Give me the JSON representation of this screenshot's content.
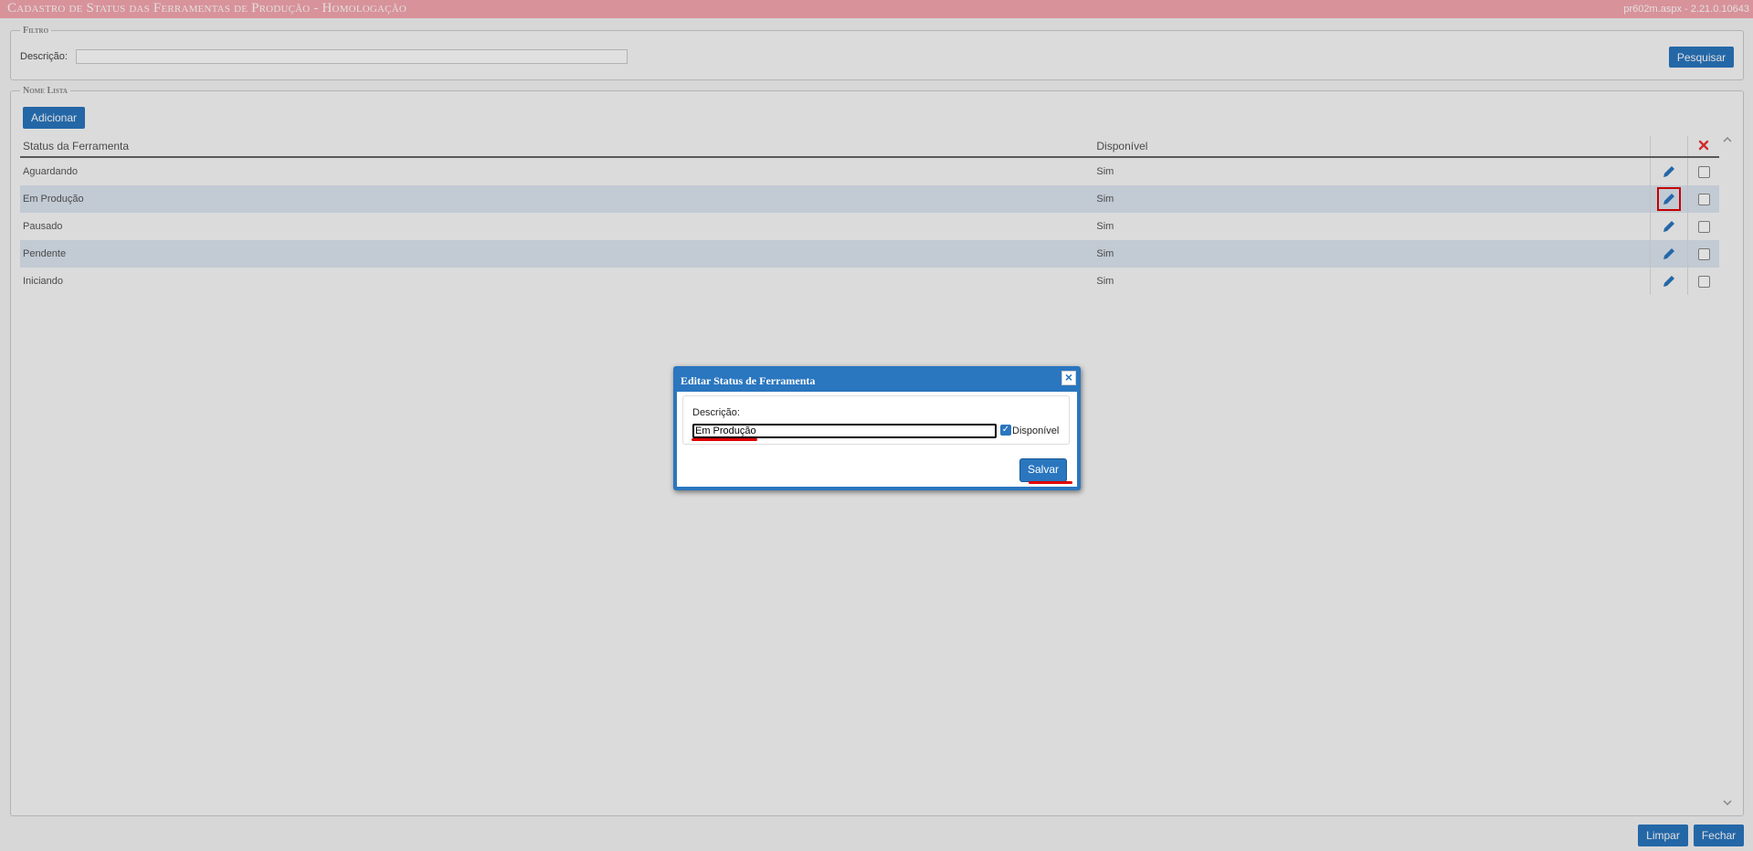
{
  "header": {
    "title": "Cadastro de Status das Ferramentas de Produção  - Homologação",
    "version": "pr602m.aspx - 2.21.0.10643"
  },
  "filter": {
    "legend": "Filtro",
    "description_label": "Descrição:",
    "description_value": "",
    "search_label": "Pesquisar"
  },
  "list": {
    "legend": "Nome Lista",
    "add_label": "Adicionar",
    "columns": {
      "status": "Status da Ferramenta",
      "available": "Disponível"
    },
    "rows": [
      {
        "status": "Aguardando",
        "available": "Sim"
      },
      {
        "status": "Em Produção",
        "available": "Sim"
      },
      {
        "status": "Pausado",
        "available": "Sim"
      },
      {
        "status": "Pendente",
        "available": "Sim"
      },
      {
        "status": "Iniciando",
        "available": "Sim"
      }
    ]
  },
  "footer": {
    "clear_label": "Limpar",
    "close_label": "Fechar"
  },
  "dialog": {
    "title": "Editar Status de Ferramenta",
    "description_label": "Descrição:",
    "description_value": "Em Produção",
    "available_label": "Disponível",
    "available_checked": true,
    "save_label": "Salvar"
  },
  "icons": {
    "edit": "pencil-icon",
    "delete_all": "red-x-icon",
    "close": "close-icon"
  },
  "colors": {
    "accent": "#2a76bf",
    "title_bar": "#f6a7b0",
    "highlight": "#e00000",
    "row_alt": "#dde6f2"
  }
}
